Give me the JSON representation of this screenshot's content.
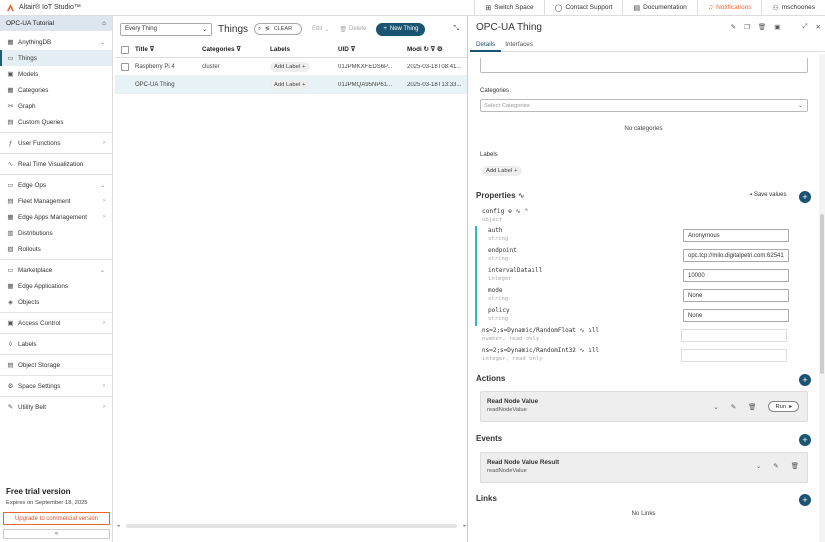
{
  "app": {
    "title": "Altair® IoT Studio™"
  },
  "topnav": {
    "switch_space": "Switch Space",
    "contact_support": "Contact Support",
    "documentation": "Documentation",
    "notifications": "Notifications",
    "user": "mschoones"
  },
  "sidebar": {
    "space_name": "OPC-UA Tutorial",
    "items": [
      {
        "label": "AnythingDB"
      },
      {
        "label": "Things"
      },
      {
        "label": "Models"
      },
      {
        "label": "Categories"
      },
      {
        "label": "Graph"
      },
      {
        "label": "Custom Queries"
      },
      {
        "label": "User Functions"
      },
      {
        "label": "Real Time Visualization"
      },
      {
        "label": "Edge Ops"
      },
      {
        "label": "Fleet Management"
      },
      {
        "label": "Edge Apps Management"
      },
      {
        "label": "Distributions"
      },
      {
        "label": "Rollouts"
      },
      {
        "label": "Marketplace"
      },
      {
        "label": "Edge Applications"
      },
      {
        "label": "Objects"
      },
      {
        "label": "Access Control"
      },
      {
        "label": "Labels"
      },
      {
        "label": "Object Storage"
      },
      {
        "label": "Space Settings"
      },
      {
        "label": "Utility Belt"
      }
    ],
    "trial_title": "Free trial version",
    "trial_expires": "Expires on September 18, 2025",
    "upgrade_label": "Upgrade to commercial version",
    "collapse_label": "«"
  },
  "things": {
    "filter_value": "Every Thing",
    "title": "Things",
    "clear_label": "CLEAR",
    "edit_label": "Edit",
    "delete_label": "Delete",
    "new_label": "New Thing",
    "columns": {
      "title": "Title",
      "categories": "Categories",
      "labels": "Labels",
      "uid": "UID",
      "modified": "Modi"
    },
    "rows": [
      {
        "title": "Raspberry Pi 4",
        "categories": "cluster",
        "label_btn": "Add Label",
        "uid": "01JPMKXFEDS6P...",
        "modified": "2025-03-18T08:41..."
      },
      {
        "title": "OPC-UA Thing",
        "categories": "",
        "label_btn": "Add Label",
        "uid": "01JPMQA95NP61...",
        "modified": "2025-03-18T13:33..."
      }
    ]
  },
  "detail": {
    "title": "OPC-UA Thing",
    "tabs": {
      "details": "Details",
      "interfaces": "Interfaces"
    },
    "categories_label": "Categories",
    "categories_placeholder": "Select Categories",
    "no_categories": "No categories",
    "labels_label": "Labels",
    "add_label": "Add Label",
    "properties_title": "Properties",
    "save_values": "Save values",
    "config": {
      "name": "config",
      "type": "object"
    },
    "props": [
      {
        "name": "auth",
        "type": "string",
        "value": "Anonymous"
      },
      {
        "name": "endpoint",
        "type": "string",
        "value": "opc.tcp://milo.digitalpetri.com:62541"
      },
      {
        "name": "intervalData",
        "type": "integer",
        "value": "10000"
      },
      {
        "name": "mode",
        "type": "string",
        "value": "None"
      },
      {
        "name": "policy",
        "type": "string",
        "value": "None"
      }
    ],
    "readonly_props": [
      {
        "name": "ns=2;s=Dynamic/RandomFloat",
        "type": "number, read only"
      },
      {
        "name": "ns=2;s=Dynamic/RandomInt32",
        "type": "integer, read only"
      }
    ],
    "actions_title": "Actions",
    "action": {
      "title": "Read Node Value",
      "id": "readNodeValue",
      "run_label": "Run"
    },
    "events_title": "Events",
    "event": {
      "title": "Read Node Value Result",
      "id": "readNodeValue"
    },
    "links_title": "Links",
    "no_links": "No Links"
  },
  "colors": {
    "accent": "#1a5470",
    "notification": "#e8692d",
    "property_bar": "#35b5c8"
  }
}
